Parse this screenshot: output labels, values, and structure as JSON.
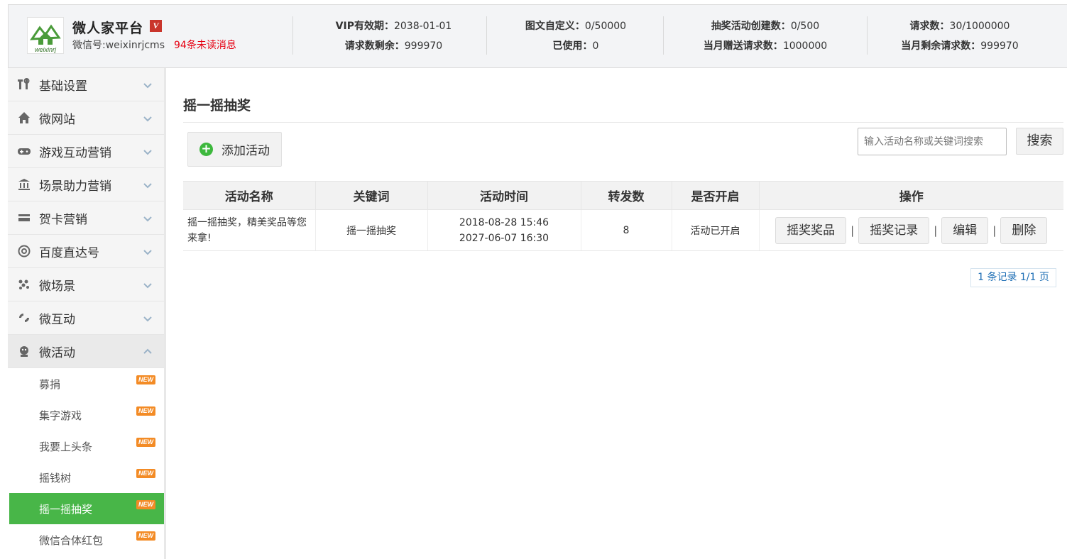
{
  "header": {
    "brand_name": "微人家平台",
    "vip_badge": "V",
    "wechat_id": "微信号:weixinrjcms",
    "unread": "94条未读消息",
    "logo_text": "weixinrj",
    "stats": [
      {
        "label1": "VIP有效期：",
        "value1": "2038-01-01",
        "label2": "请求数剩余：",
        "value2": "999970"
      },
      {
        "label1": "图文自定义：",
        "value1": "0/50000",
        "label2": "已使用：",
        "value2": "0"
      },
      {
        "label1": "抽奖活动创建数：",
        "value1": "0/500",
        "label2": "当月赠送请求数：",
        "value2": "1000000"
      },
      {
        "label1": "请求数：",
        "value1": "30/1000000",
        "label2": "当月剩余请求数：",
        "value2": "999970"
      }
    ]
  },
  "sidebar": {
    "items": [
      {
        "label": "基础设置",
        "icon": "tools-icon"
      },
      {
        "label": "微网站",
        "icon": "home-icon"
      },
      {
        "label": "游戏互动营销",
        "icon": "gamepad-icon"
      },
      {
        "label": "场景助力营销",
        "icon": "bank-icon"
      },
      {
        "label": "贺卡营销",
        "icon": "card-icon"
      },
      {
        "label": "百度直达号",
        "icon": "at-icon"
      },
      {
        "label": "微场景",
        "icon": "dots-icon"
      },
      {
        "label": "微互动",
        "icon": "interact-icon"
      },
      {
        "label": "微活动",
        "icon": "activity-icon"
      }
    ],
    "sub_items": [
      {
        "label": "募捐",
        "badge": "NEW"
      },
      {
        "label": "集字游戏",
        "badge": "NEW"
      },
      {
        "label": "我要上头条",
        "badge": "NEW"
      },
      {
        "label": "摇钱树",
        "badge": "NEW"
      },
      {
        "label": "摇一摇抽奖",
        "badge": "NEW"
      },
      {
        "label": "微信合体红包",
        "badge": "NEW"
      }
    ],
    "active_sub": "摇一摇抽奖"
  },
  "main": {
    "title": "摇一摇抽奖",
    "add_button": "添加活动",
    "search_placeholder": "输入活动名称或关键词搜索",
    "search_button": "搜索",
    "table": {
      "headers": [
        "活动名称",
        "关键词",
        "活动时间",
        "转发数",
        "是否开启",
        "操作"
      ],
      "rows": [
        {
          "name": "摇一摇抽奖，精美奖品等您来拿!",
          "keyword": "摇一摇抽奖",
          "time_start": "2018-08-28 15:46",
          "time_end": "2027-06-07 16:30",
          "shares": "8",
          "status": "活动已开启",
          "actions": [
            "摇奖奖品",
            "摇奖记录",
            "编辑",
            "删除"
          ]
        }
      ]
    },
    "pagination": "1 条记录 1/1 页"
  },
  "colors": {
    "accent_green": "#48b648",
    "unread_red": "#e60012",
    "status_green": "#1e8a1e",
    "pager_blue": "#1f6fb5",
    "new_badge_orange": "#f38b25"
  }
}
